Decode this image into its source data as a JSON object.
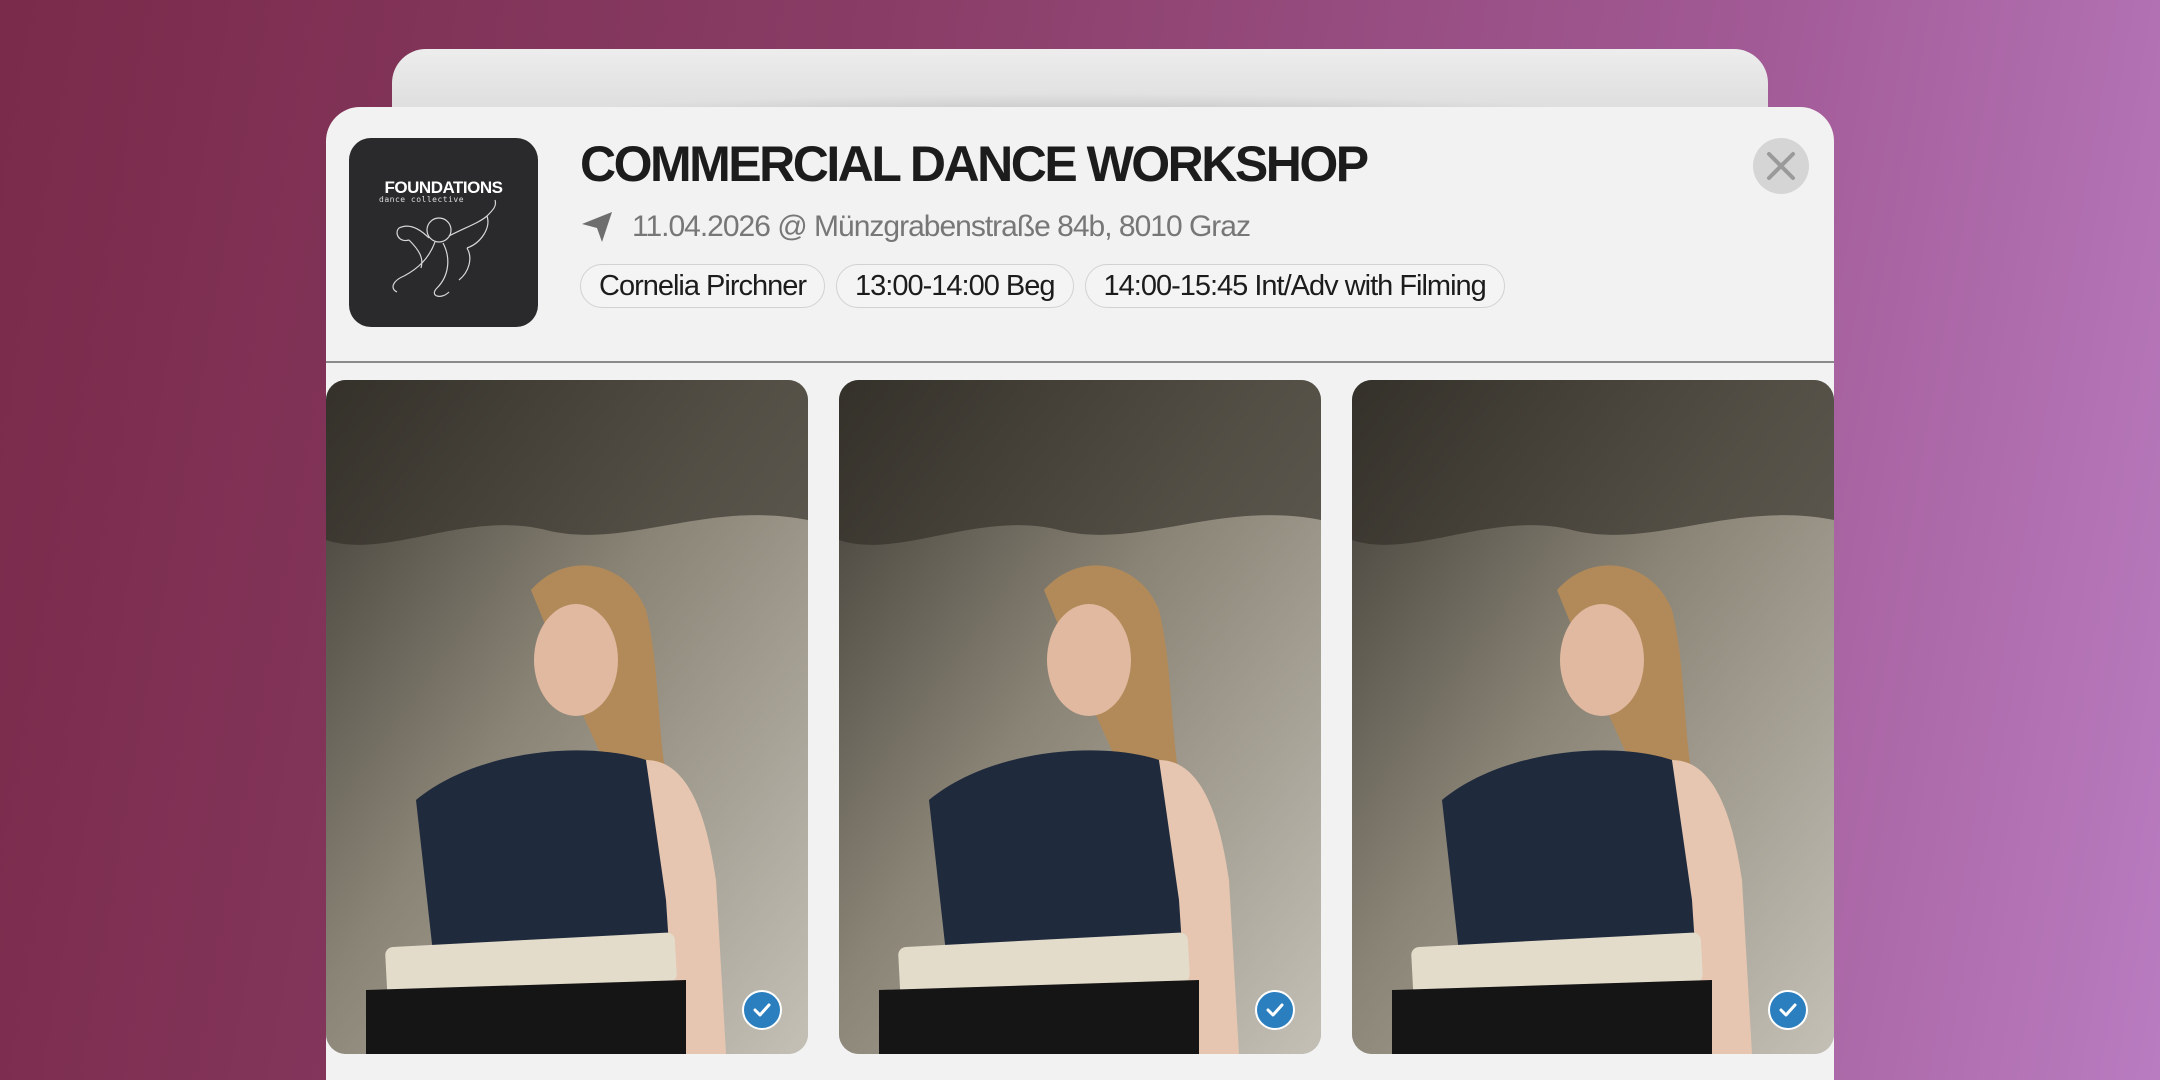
{
  "event": {
    "title": "COMMERCIAL DANCE WORKSHOP",
    "location_line": "11.04.2026 @ Münzgrabenstraße 84b, 8010 Graz",
    "location_icon": "navigation-arrow-icon",
    "chips": [
      "Cornelia Pirchner",
      "13:00-14:00 Beg",
      "14:00-15:45 Int/Adv with Filming"
    ]
  },
  "logo": {
    "name": "FOUNDATIONS",
    "subtitle": "dance collective"
  },
  "close": {
    "icon": "close-icon"
  },
  "photos": [
    {
      "alt": "dancer-photo",
      "selected": true,
      "icon": "check-icon"
    },
    {
      "alt": "dancer-photo",
      "selected": true,
      "icon": "check-icon"
    },
    {
      "alt": "dancer-photo",
      "selected": true,
      "icon": "check-icon"
    }
  ],
  "colors": {
    "card": "#f2f2f2",
    "title": "#1c1c1c",
    "muted": "#777777",
    "check": "#2c7fbf",
    "logo_bg": "#2a2a2c"
  }
}
